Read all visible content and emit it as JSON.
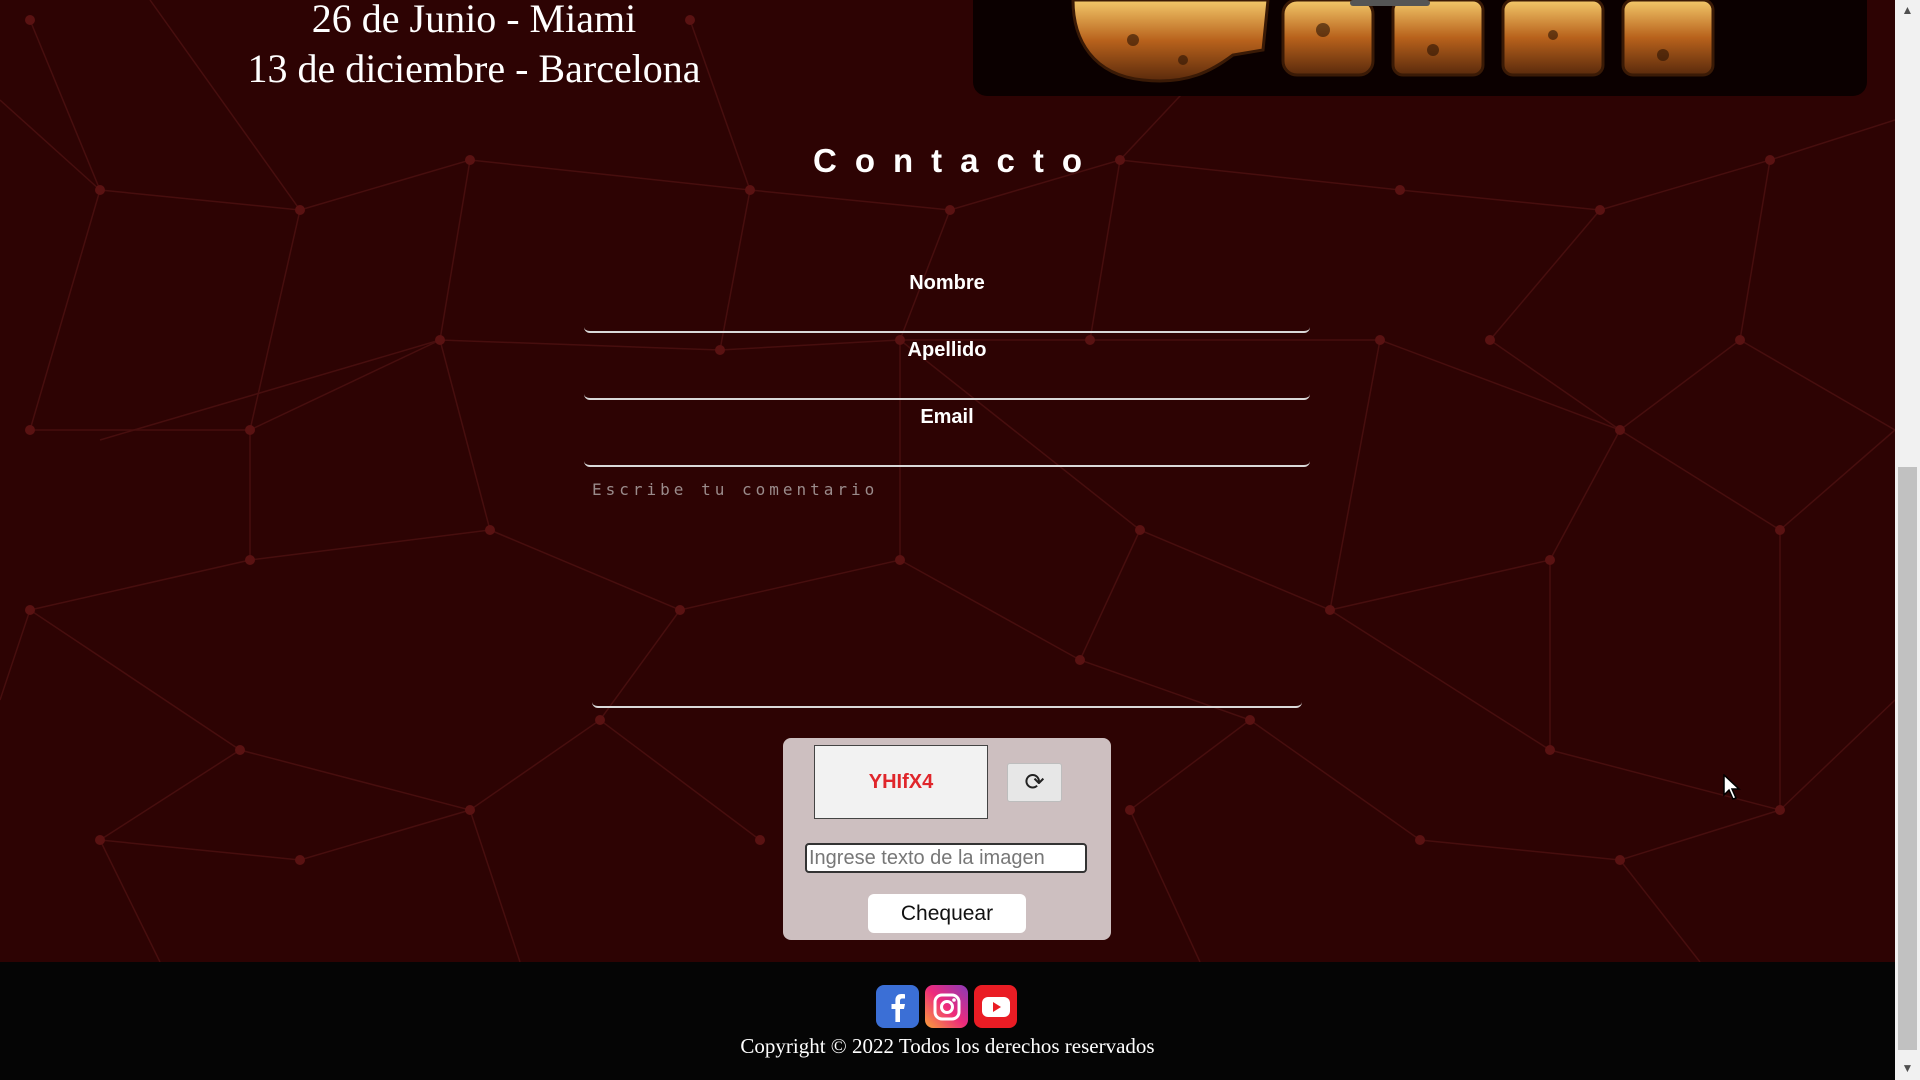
{
  "events": {
    "line1": "26 de Junio - Miami",
    "line2": "13 de diciembre - Barcelona"
  },
  "contact": {
    "title": "Contacto",
    "fields": [
      {
        "label": "Nombre",
        "value": ""
      },
      {
        "label": "Apellido",
        "value": ""
      },
      {
        "label": "Email",
        "value": ""
      }
    ],
    "comment_placeholder": "Escribe tu comentario"
  },
  "captcha": {
    "code": "YHIfX4",
    "refresh_icon": "refresh-icon",
    "input_placeholder": "Ingrese texto de la imagen",
    "check_label": "Chequear"
  },
  "footer": {
    "social": [
      "facebook-icon",
      "instagram-icon",
      "youtube-icon"
    ],
    "copyright": "Copyright © 2022 Todos los derechos reservados"
  },
  "colors": {
    "background": "#2d0303",
    "footer": "#050505",
    "captcha_panel": "#cdbfc0",
    "captcha_text": "#e0262b"
  }
}
